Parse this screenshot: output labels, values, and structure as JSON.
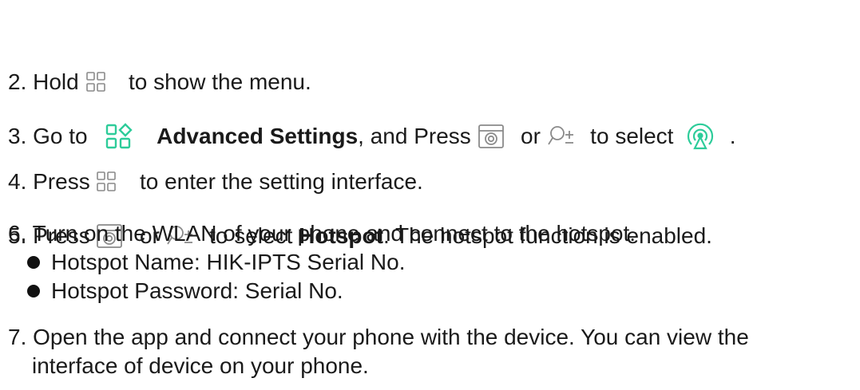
{
  "steps": {
    "s2": {
      "a": "2. Hold ",
      "b": " to show the menu."
    },
    "s3": {
      "a": "3. Go to ",
      "b": "Advanced Settings",
      "c": ", and Press ",
      "d": " or ",
      "e": " to select ",
      "f": " ."
    },
    "s4": {
      "a": "4. Press ",
      "b": " to enter the setting interface."
    },
    "s5": {
      "a": "5. Press ",
      "b": " or ",
      "c": " to select ",
      "d": "Hotspot",
      "e": ". The hotspot function is enabled."
    },
    "s6": {
      "text": "6. Turn on the WLAN of your phone and connect to the hotspot.",
      "bullets": [
        "Hotspot Name: HIK-IPTS Serial No.",
        "Hotspot Password: Serial No."
      ]
    },
    "s7": {
      "line1": "7. Open the app and connect your phone with the device. You can view the",
      "line2": "interface of device on your phone."
    }
  },
  "icons": {
    "menu": "menu-grid-icon",
    "advanced_settings": "advanced-settings-icon",
    "camera": "camera-icon",
    "zoom": "zoom-plus-minus-icon",
    "hotspot": "hotspot-icon"
  },
  "colors": {
    "text": "#1a1a1a",
    "icon_gray": "#8a8a8a",
    "accent_green": "#2ecc9a"
  }
}
